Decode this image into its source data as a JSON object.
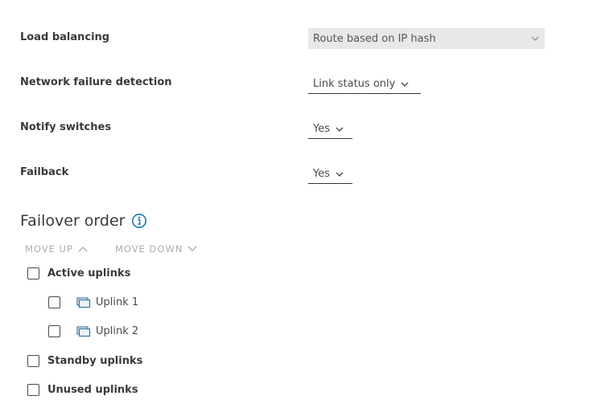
{
  "settings": {
    "load_balancing": {
      "label": "Load balancing",
      "value": "Route based on IP hash"
    },
    "network_failure": {
      "label": "Network failure detection",
      "value": "Link status only"
    },
    "notify_switches": {
      "label": "Notify switches",
      "value": "Yes"
    },
    "failback": {
      "label": "Failback",
      "value": "Yes"
    }
  },
  "failover": {
    "title": "Failover order",
    "move_up": "MOVE UP",
    "move_down": "MOVE DOWN",
    "groups": {
      "active": "Active uplinks",
      "uplink1": "Uplink 1",
      "uplink2": "Uplink 2",
      "standby": "Standby uplinks",
      "unused": "Unused uplinks"
    }
  },
  "colors": {
    "info_accent": "#1a78b8",
    "disabled_text": "#a8aeb3"
  }
}
